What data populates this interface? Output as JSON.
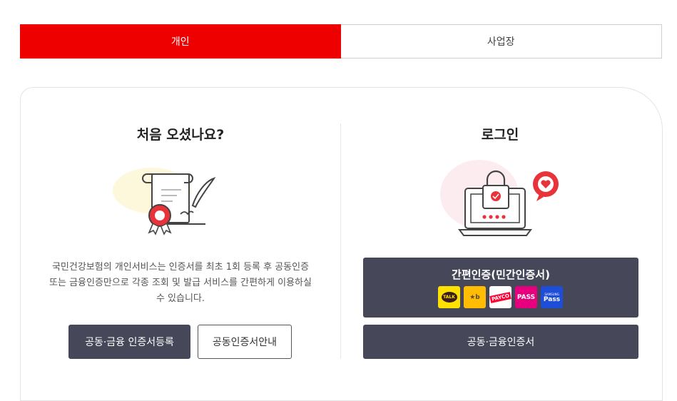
{
  "tabs": [
    {
      "label": "개인",
      "active": true
    },
    {
      "label": "사업장",
      "active": false
    }
  ],
  "left": {
    "title": "처음 오셨나요?",
    "description_lines": [
      "국민건강보험의 개인서비스는 인증서를 최초 1회 등록 후 공동인증",
      "또는 금융인증만으로 각종 조회 및 발급 서비스를 간편하게 이용하실",
      "수 있습니다."
    ],
    "register_button": "공동·금융 인증서등록",
    "guide_button": "공동인증서안내"
  },
  "right": {
    "title": "로그인",
    "easy_auth_label": "간편인증(민간인증서)",
    "joint_auth_button": "공동·금융인증서",
    "providers": [
      {
        "name": "kakaotalk",
        "text": "TALK"
      },
      {
        "name": "kb",
        "text": "★b"
      },
      {
        "name": "payco",
        "text": "PAYCO"
      },
      {
        "name": "pass",
        "text": "PASS"
      },
      {
        "name": "samsung-pass",
        "text": "Pass",
        "sub": "SAMSUNG"
      }
    ]
  },
  "colors": {
    "accent": "#ef0000",
    "button_dark": "#464758"
  }
}
